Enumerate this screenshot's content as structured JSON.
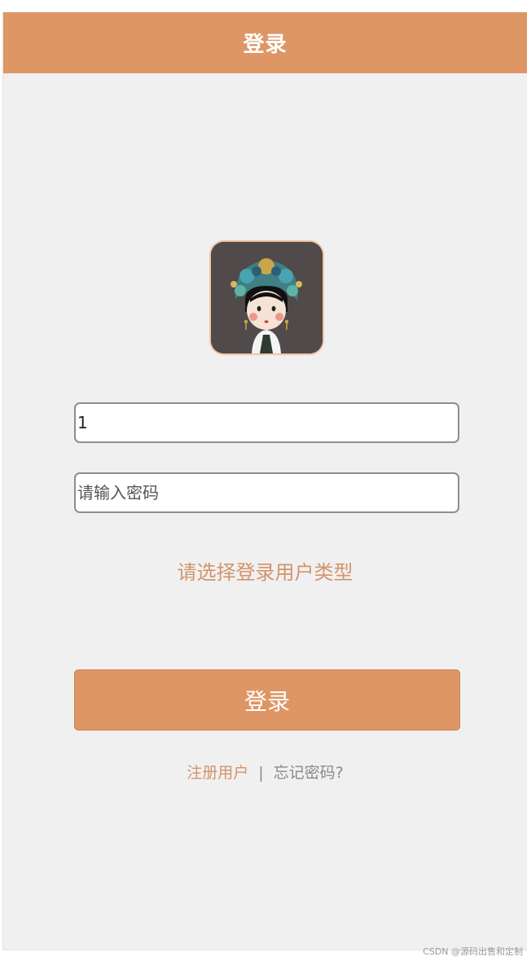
{
  "header": {
    "title": "登录"
  },
  "avatar": {
    "icon": "empress-avatar"
  },
  "form": {
    "username_value": "1",
    "password_placeholder": "请输入密码",
    "user_type_label": "请选择登录用户类型",
    "submit_label": "登录"
  },
  "links": {
    "register": "注册用户",
    "separator": "|",
    "forgot": "忘记密码?"
  },
  "watermark": "CSDN @源码出售和定制",
  "colors": {
    "accent": "#de9665",
    "link": "#d2946a",
    "background": "#f1f0f0"
  }
}
